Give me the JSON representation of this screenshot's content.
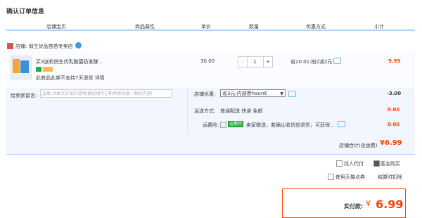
{
  "page_title": "确认订单信息",
  "columns": [
    "店铺宝贝",
    "商品属性",
    "单价",
    "数量",
    "优惠方式",
    "小计"
  ],
  "shop": {
    "label": "店铺:",
    "name": "俏生优品苗苗专卖店"
  },
  "item": {
    "name": "买3送机俏生优乳酸菌奶发酵...",
    "promise": "此商品此券不支持7天退货 详情",
    "price": "30.00",
    "qty": "1",
    "qty_minus": "-",
    "qty_plus": "+",
    "discount": "省20.01:拍2减2元",
    "subtotal": "9.99"
  },
  "message": {
    "label": "给卖家留言:",
    "placeholder": "选填:对本次交易的说明(建议填写已和卖家协商一致的内容)"
  },
  "shop_discount": {
    "label": "店铺优惠:",
    "selected": "省3元:内部券haun6",
    "amount": "-3.00"
  },
  "shipping": {
    "label": "运送方式:",
    "value": "普通配送 快递 免邮",
    "amount": "0.00"
  },
  "insurance": {
    "label": "运费险:",
    "tag": "运费险",
    "desc": "卖家赠送，若确认收货前退货，可获保...",
    "amount": "0.00"
  },
  "shop_total": {
    "label": "店铺合计(含运费)",
    "amount": "¥6.99"
  },
  "options": {
    "proxy": "找人代付",
    "anonymous": "匿名购买",
    "tmall_points": "使用天猫点券",
    "points_note": "结算时扣除"
  },
  "final": {
    "label": "实付款:",
    "currency": "¥",
    "amount": "6.99"
  },
  "colors": {
    "accent": "#ff4400",
    "header_line": "#b2d1ff",
    "green": "#27a844"
  }
}
